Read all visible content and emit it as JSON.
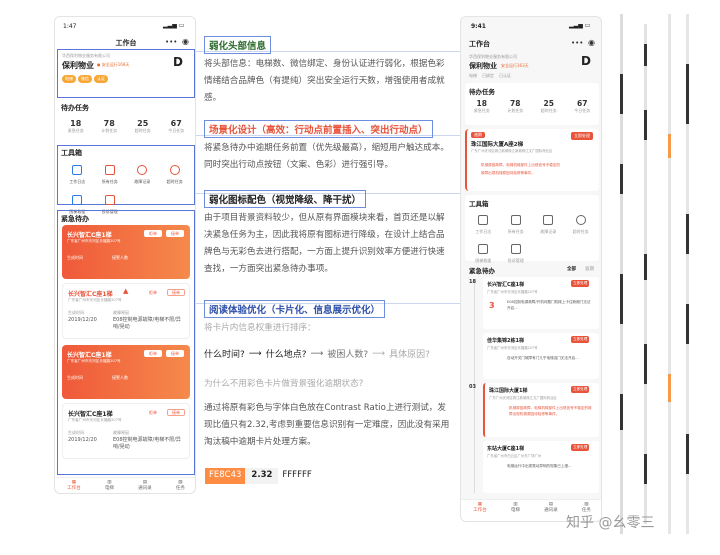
{
  "left_phone": {
    "status_time": "1:47",
    "title": "工作台",
    "company_sub": "华西保利物业服务有限公司",
    "company": "保利物业",
    "safe_days": "安全运行168天",
    "tags": [
      "电梯",
      "微信",
      "认证"
    ],
    "todo_title": "待办任务",
    "stats": [
      {
        "num": "18",
        "label": "紧急任务"
      },
      {
        "num": "78",
        "label": "计划任务"
      },
      {
        "num": "25",
        "label": "超时任务"
      },
      {
        "num": "67",
        "label": "今日任务"
      }
    ],
    "toolbox_title": "工具箱",
    "tools": [
      {
        "label": "工作日志"
      },
      {
        "label": "所有任务"
      },
      {
        "label": "故障记录"
      },
      {
        "label": "超时任务"
      },
      {
        "label": "困梯救援"
      },
      {
        "label": "投诉管理"
      }
    ],
    "urgent_title": "紧急待办",
    "cards": [
      {
        "name": "长兴智汇C座1梯",
        "addr": "广东省广州市天河区长福路207号",
        "btn1": "拒单",
        "btn2": "接单",
        "col1": "生成时间",
        "col2": "接警人数",
        "v1": "",
        "v2": ""
      },
      {
        "name": "长兴智汇C座1梯",
        "addr": "广东省广州市天河区长福路207号",
        "btn1": "拒单",
        "btn2": "接单",
        "col1": "生成时间",
        "col2": "故障原因",
        "v1": "2019/12/20",
        "v2": "E08控制电源故障/电梯不限/异响/晃动"
      },
      {
        "name": "长兴智汇C座1梯",
        "addr": "广东省广州市天河区长福路207号",
        "btn1": "拒单",
        "btn2": "接单",
        "col1": "生成时间",
        "col2": "接警人数",
        "v1": "",
        "v2": ""
      },
      {
        "name": "长兴智汇C座1梯",
        "addr": "广东省广州市天河区长福路207号",
        "btn1": "拒单",
        "btn2": "接单",
        "col1": "生成时间",
        "col2": "故障原因",
        "v1": "2019/12/20",
        "v2": "E08控制电源故障/电梯不限/异响/晃动"
      }
    ],
    "nav": [
      "工作台",
      "电梯",
      "通讯录",
      "任务"
    ]
  },
  "middle": {
    "s1_title": "弱化头部信息",
    "s1_text": "将头部信息：电梯数、微信绑定、身份认证进行弱化，根据色彩情绪结合品牌色（有提纯）突出安全运行天数，增强使用者成就感。",
    "s2_title": "场景化设计（高效：行动点前置插入、突出行动点）",
    "s2_text": "将紧急待办中逾期任务前置（优先级最高），缩短用户触达成本。同时突出行动点按钮（文案、色彩）进行强引导。",
    "s3_title": "弱化图标配色（视觉降级、降干扰）",
    "s3_text": "由于项目背景资料较少，但从原有界面模块来看，首页还是以解决紧急任务为主，因此我将原有图标进行降级，在设计上结合品牌色与无彩色去进行搭配，一方面上提升识别效率方便进行快速查找，一方面突出紧急待办事项。",
    "s4_title": "阅读体验优化（卡片化、信息展示优化）",
    "s4_sub": "将卡片内信息权重进行排序：",
    "flow": [
      "什么时间?",
      "什么地点?",
      "被困人数?",
      "具体原因?"
    ],
    "q": "为什么不用彩色卡片做背景强化逾期状态?",
    "s4_text": "通过将原有彩色与字体白色放在Contrast Ratio上进行测试，发现比值只有2.32,考虑到重要信息识别有一定难度，因此没有采用淘汰稿中逾期卡片处理方案。",
    "ratio": [
      "FE8C43",
      "2.32",
      "FFFFFF"
    ],
    "colors": {
      "orange": "#FE8C43",
      "white": "#FFFFFF"
    }
  },
  "right_phone": {
    "status_time": "9:41",
    "title": "工作台",
    "company_sub": "华西保利物业服务有限公司",
    "company": "保利物业",
    "safe_days": "安全运行163天",
    "tags": [
      "电梯",
      "已绑定",
      "已认证"
    ],
    "todo_title": "待办任务",
    "stats": [
      {
        "num": "18",
        "label": "紧急任务"
      },
      {
        "num": "78",
        "label": "计划任务"
      },
      {
        "num": "25",
        "label": "超时任务"
      },
      {
        "num": "67",
        "label": "今日任务"
      }
    ],
    "overdue": {
      "badge": "逾期",
      "name": "珠江国际大厦A座2梯",
      "addr": "广东广州天河区珠江新城珠江新城珠江文广国际商业区",
      "btn": "立即处理",
      "text1": "机械原因故障，电梯机械部件上出现信号不稳定的",
      "text2": "故障出现机械原因待检修等事件。"
    },
    "toolbox_title": "工具箱",
    "tools": [
      {
        "label": "工作日志"
      },
      {
        "label": "所有任务"
      },
      {
        "label": "故障记录"
      },
      {
        "label": "超时任务"
      },
      {
        "label": "困梯救援"
      },
      {
        "label": "投诉管理"
      }
    ],
    "urgent_title": "紧急待办",
    "tabs": [
      "全部",
      "逾期"
    ],
    "timeline": [
      {
        "day": "18",
        "name": "长兴智汇C座1梯",
        "addr": "广东省广州市天河区长福路207号",
        "btn": "立即处理",
        "n": "3",
        "text": "E08控制电源故障/开机问题门机械上卡住轿厢门无法开启..."
      },
      {
        "day": "",
        "name": "佳华集锦2栋1梯",
        "addr": "广东省广州市天河区长福路207号",
        "btn": "立即处理",
        "n": "",
        "text": "自动开关门故障有门几乎电梯连门无法开启..."
      },
      {
        "day": "03",
        "name": "珠江国际大厦1梯",
        "addr": "广东广州天河区珠江新城珠江文广国际商业区",
        "btn": "立即处理",
        "n": "",
        "text": "机械原因故障，电梯机械部件上出现信号不稳定的故障出现机械原因待检修等事件。"
      },
      {
        "day": "12",
        "name": "东站大厦C座1梯",
        "addr": "广东省广州市白云区广州东广场广州",
        "btn": "立即处理",
        "n": "",
        "text": "电梯运行中出现晃动异响的现象已上报..."
      }
    ],
    "nav": [
      "工作台",
      "电梯",
      "通讯录",
      "任务"
    ]
  },
  "watermark": "知乎 @幺零三"
}
